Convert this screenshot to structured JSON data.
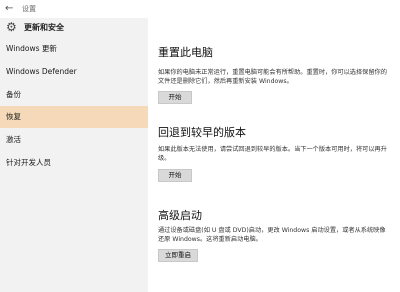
{
  "titlebar": {
    "back_glyph": "←",
    "title": "设置"
  },
  "sidebar": {
    "header": {
      "icon": "gear-icon",
      "icon_glyph": "⚙",
      "label": "更新和安全"
    },
    "items": [
      {
        "label": "Windows 更新",
        "active": false
      },
      {
        "label": "Windows Defender",
        "active": false
      },
      {
        "label": "备份",
        "active": false
      },
      {
        "label": "恢复",
        "active": true
      },
      {
        "label": "激活",
        "active": false
      },
      {
        "label": "针对开发人员",
        "active": false
      }
    ]
  },
  "main": {
    "sections": [
      {
        "title": "重置此电脑",
        "desc": "如果你的电脑未正常运行，重置电脑可能会有所帮助。重置时，你可以选择保留你的文件还是删除它们，然后再重新安装 Windows。",
        "button": "开始"
      },
      {
        "title": "回退到较早的版本",
        "desc": "如果此版本无法使用，请尝试回退到较早的版本。当下一个版本可用时，将可以再升级。",
        "button": "开始"
      },
      {
        "title": "高级启动",
        "desc": "通过设备或磁盘(如 U 盘或 DVD)启动，更改 Windows 启动设置，或者从系统映像还原 Windows。这将重新启动电脑。",
        "button": "立即重启"
      }
    ]
  },
  "colors": {
    "active_item": "#f5d9b8",
    "sidebar_bg": "#f2f2f2",
    "button_bg": "#d9d9d9"
  }
}
